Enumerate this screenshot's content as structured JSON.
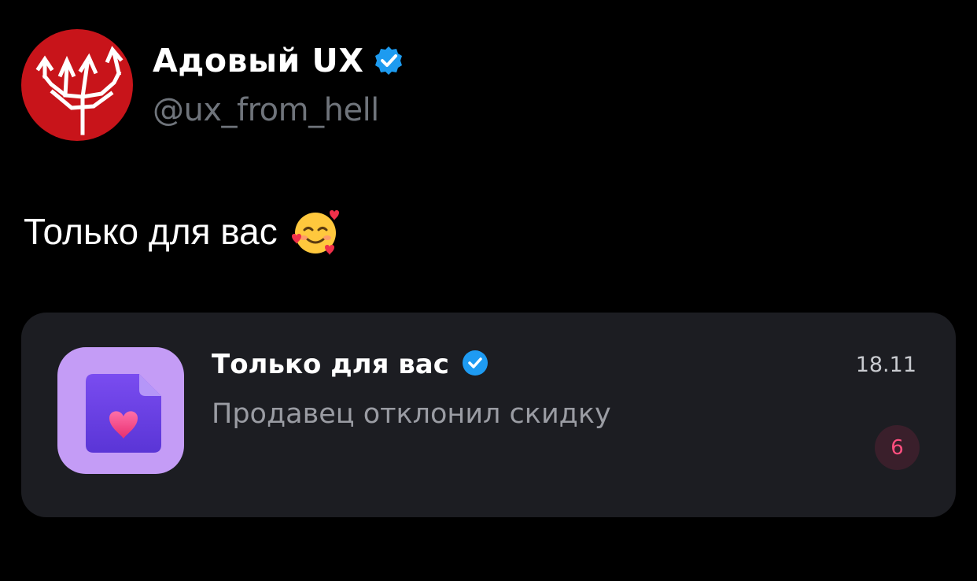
{
  "author": {
    "name": "Адовый UX",
    "handle": "@ux_from_hell",
    "avatar_icon": "trident-icon",
    "avatar_color": "#c8141a",
    "verified": true,
    "verified_color": "#1d9bf0"
  },
  "tweet": {
    "text": "Только для вас",
    "emoji": "smiling-face-with-hearts"
  },
  "notification": {
    "app_icon": "document-heart-icon",
    "title": "Только для вас",
    "verified": true,
    "body": "Продавец отклонил скидку",
    "date": "18.11",
    "badge_count": "6",
    "badge_color": "#ff4f7f",
    "icon_bg_color": "#c49cf6"
  }
}
